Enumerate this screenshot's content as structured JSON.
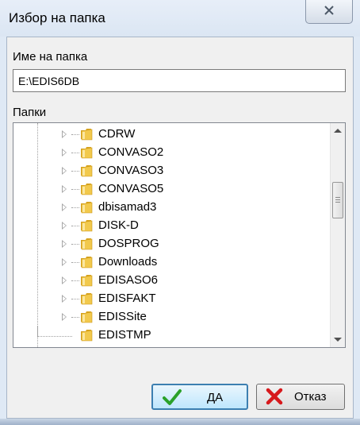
{
  "window": {
    "title": "Избор на папка",
    "close_label": "☒"
  },
  "folder_name": {
    "label": "Име на папка",
    "value": "E:\\EDIS6DB"
  },
  "folders": {
    "label": "Папки",
    "items": [
      {
        "label": "CDRW"
      },
      {
        "label": "CONVASO2"
      },
      {
        "label": "CONVASO3"
      },
      {
        "label": "CONVASO5"
      },
      {
        "label": "dbisamad3"
      },
      {
        "label": "DISK-D"
      },
      {
        "label": "DOSPROG"
      },
      {
        "label": "Downloads"
      },
      {
        "label": "EDISASO6"
      },
      {
        "label": "EDISFAKT"
      },
      {
        "label": "EDISSite"
      },
      {
        "label": "EDISTMP"
      }
    ]
  },
  "buttons": {
    "ok_label": "ДА",
    "cancel_label": "Отказ"
  },
  "colors": {
    "folder_yellow": "#f2c94c",
    "ok_check_green": "#2aa12a",
    "cancel_x_red": "#d7191c",
    "focus_blue": "#3c7fb1"
  }
}
